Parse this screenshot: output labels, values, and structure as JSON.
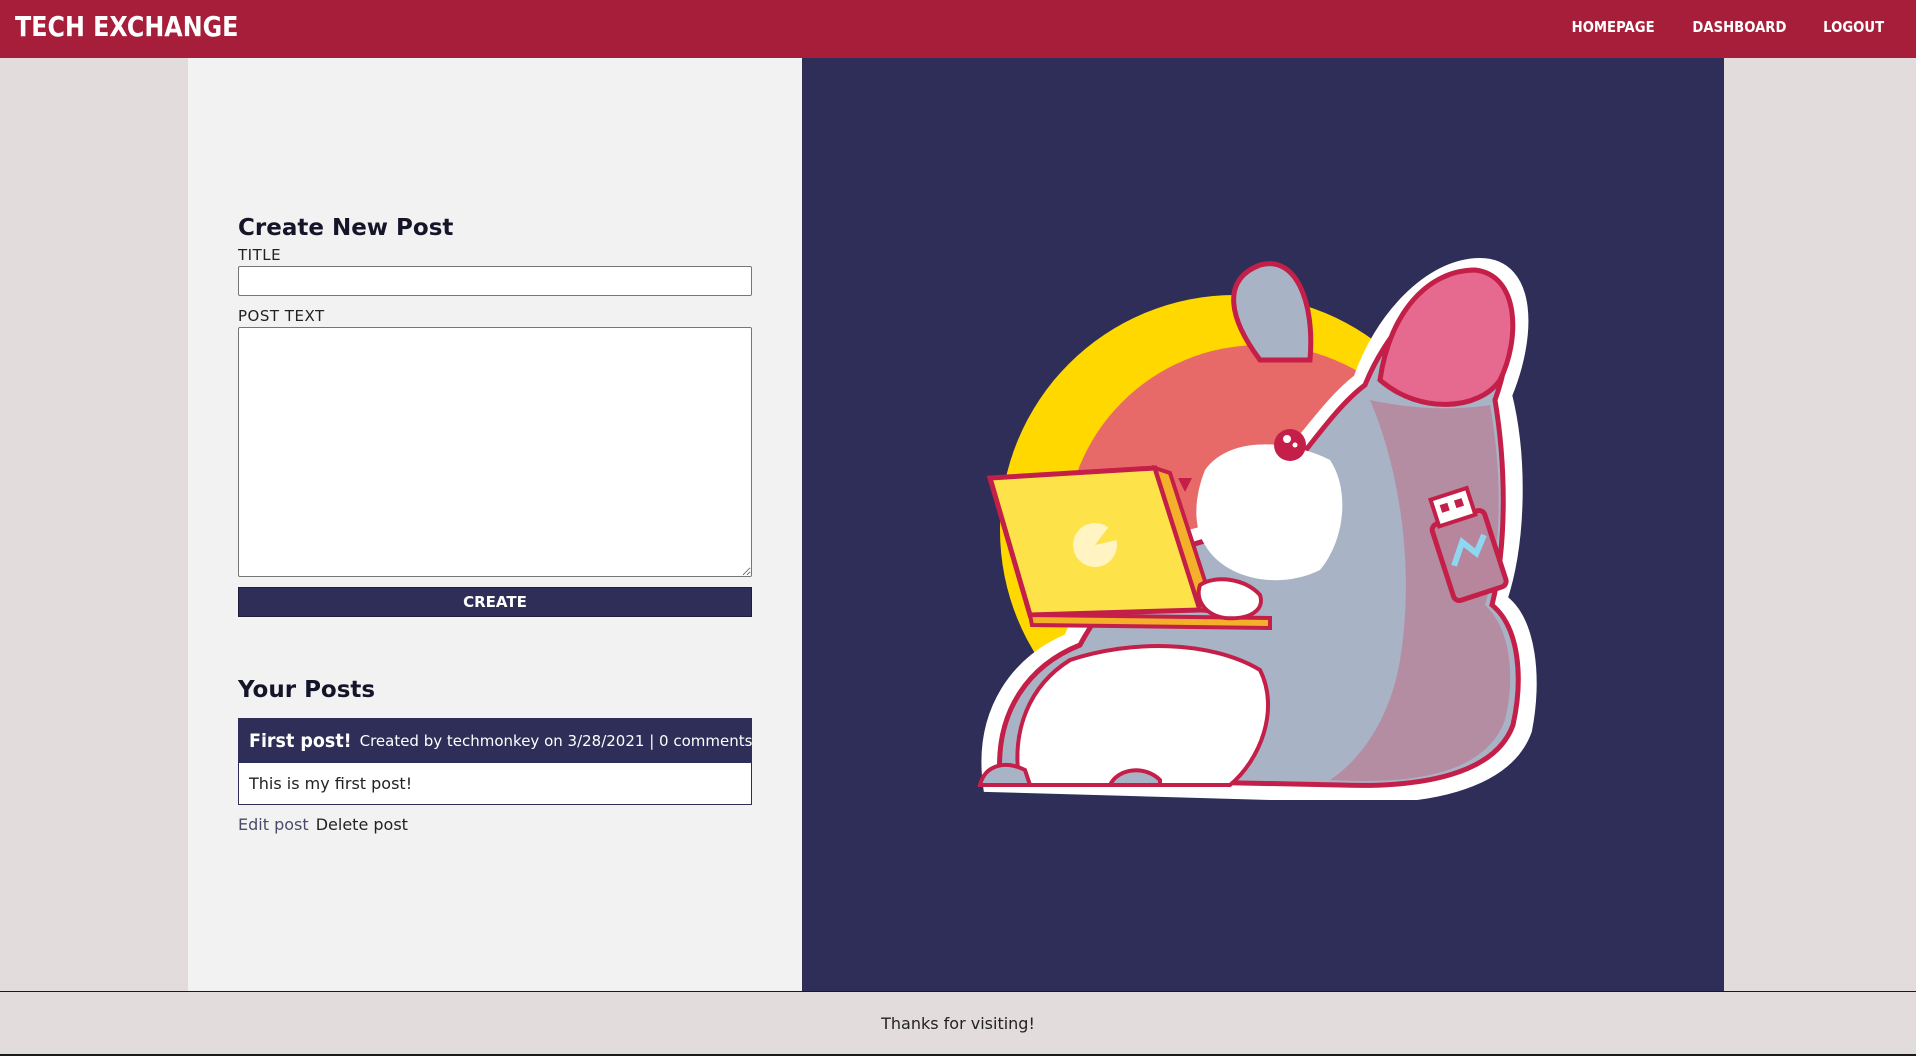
{
  "navbar": {
    "brand": "TECH EXCHANGE",
    "links": [
      {
        "label": "HOMEPAGE"
      },
      {
        "label": "DASHBOARD"
      },
      {
        "label": "LOGOUT"
      }
    ]
  },
  "create_form": {
    "heading": "Create New Post",
    "title_label": "TITLE",
    "title_value": "",
    "text_label": "POST TEXT",
    "text_value": "",
    "submit_label": "CREATE"
  },
  "your_posts": {
    "heading": "Your Posts",
    "posts": [
      {
        "title": "First post!",
        "meta": "Created by techmonkey on 3/28/2021 | 0 comments",
        "body": "This is my first post!",
        "edit_label": "Edit post",
        "delete_label": "Delete post"
      }
    ]
  },
  "illustration": {
    "icon": "mouse-with-laptop-and-usb-illustration"
  },
  "footer": {
    "text": "Thanks for visiting!"
  },
  "colors": {
    "navbar": "#a61e39",
    "accent_navy": "#2e2e58",
    "page_bg": "#e3dcdc",
    "panel_bg": "#f2f2f2"
  }
}
